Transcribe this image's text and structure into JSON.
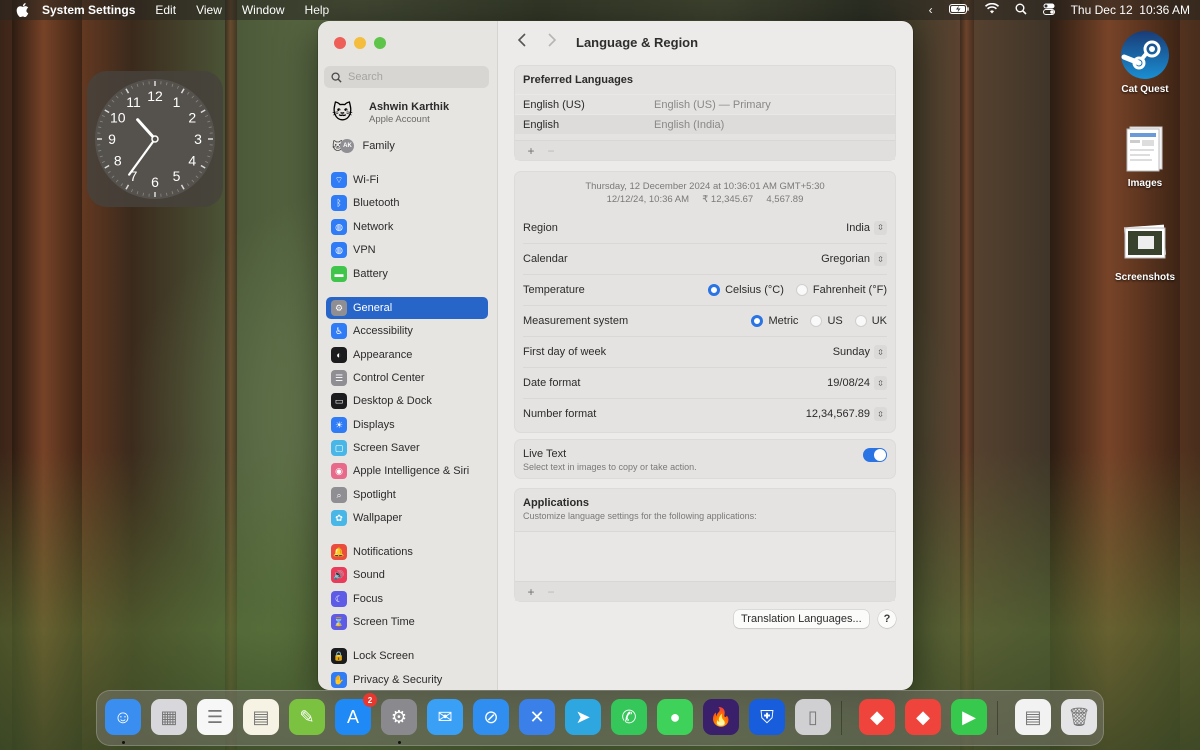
{
  "menubar": {
    "app_name": "System Settings",
    "menus": [
      "Edit",
      "View",
      "Window",
      "Help"
    ],
    "status_icons": [
      "chevron-left-icon",
      "battery-charging-icon",
      "wifi-icon",
      "search-icon",
      "control-center-icon"
    ],
    "datetime": "Thu Dec 12  10:36 AM"
  },
  "clock_widget": {
    "numbers": [
      "12",
      "1",
      "2",
      "3",
      "4",
      "5",
      "6",
      "7",
      "8",
      "9",
      "10",
      "11"
    ],
    "hour": 10,
    "minute": 36
  },
  "desktop_icons": [
    {
      "label": "Cat Quest",
      "icon": "steam-icon"
    },
    {
      "label": "Images",
      "icon": "folder-stack-icon"
    },
    {
      "label": "Screenshots",
      "icon": "screenshot-stack-icon"
    }
  ],
  "window": {
    "search_placeholder": "Search",
    "account": {
      "name": "Ashwin Karthik",
      "subtitle": "Apple Account"
    },
    "family": {
      "label": "Family",
      "initials": "AK"
    },
    "sidebar": [
      {
        "label": "Wi-Fi",
        "icon": "wifi-icon",
        "color": "#2f7cf6"
      },
      {
        "label": "Bluetooth",
        "icon": "bluetooth-icon",
        "color": "#2f7cf6"
      },
      {
        "label": "Network",
        "icon": "globe-icon",
        "color": "#2f7cf6"
      },
      {
        "label": "VPN",
        "icon": "vpn-icon",
        "color": "#2f7cf6"
      },
      {
        "label": "Battery",
        "icon": "battery-icon",
        "color": "#3fc54a"
      },
      {
        "label": "General",
        "icon": "gear-icon",
        "color": "#8e8e93",
        "selected": true
      },
      {
        "label": "Accessibility",
        "icon": "accessibility-icon",
        "color": "#2f7cf6"
      },
      {
        "label": "Appearance",
        "icon": "appearance-icon",
        "color": "#1c1c1e"
      },
      {
        "label": "Control Center",
        "icon": "control-center-icon",
        "color": "#8e8e93"
      },
      {
        "label": "Desktop & Dock",
        "icon": "dock-icon",
        "color": "#1c1c1e"
      },
      {
        "label": "Displays",
        "icon": "sun-icon",
        "color": "#2f7cf6"
      },
      {
        "label": "Screen Saver",
        "icon": "screen-saver-icon",
        "color": "#48b7e8"
      },
      {
        "label": "Apple Intelligence & Siri",
        "icon": "siri-icon",
        "color": "#e86a8a"
      },
      {
        "label": "Spotlight",
        "icon": "spotlight-icon",
        "color": "#8e8e93"
      },
      {
        "label": "Wallpaper",
        "icon": "wallpaper-icon",
        "color": "#48b7e8"
      },
      {
        "label": "Notifications",
        "icon": "bell-icon",
        "color": "#eb4d3d"
      },
      {
        "label": "Sound",
        "icon": "speaker-icon",
        "color": "#eb3b5a"
      },
      {
        "label": "Focus",
        "icon": "moon-icon",
        "color": "#5e5ce6"
      },
      {
        "label": "Screen Time",
        "icon": "hourglass-icon",
        "color": "#5e5ce6"
      },
      {
        "label": "Lock Screen",
        "icon": "lock-icon",
        "color": "#1c1c1e"
      },
      {
        "label": "Privacy & Security",
        "icon": "hand-icon",
        "color": "#2f7cf6"
      }
    ],
    "title": "Language & Region",
    "preferred_languages": {
      "heading": "Preferred Languages",
      "rows": [
        {
          "name": "English (US)",
          "detail": "English (US) — Primary"
        },
        {
          "name": "English",
          "detail": "English (India)"
        }
      ],
      "add": "+",
      "remove": "−"
    },
    "preview": {
      "line1": "Thursday, 12 December 2024 at 10:36:01 AM GMT+5:30",
      "line2": "12/12/24, 10:36 AM     ₹ 12,345.67     4,567.89"
    },
    "settings": {
      "region": {
        "label": "Region",
        "value": "India"
      },
      "calendar": {
        "label": "Calendar",
        "value": "Gregorian"
      },
      "temperature": {
        "label": "Temperature",
        "options": [
          "Celsius (°C)",
          "Fahrenheit (°F)"
        ],
        "selected": "Celsius (°C)"
      },
      "measurement": {
        "label": "Measurement system",
        "options": [
          "Metric",
          "US",
          "UK"
        ],
        "selected": "Metric"
      },
      "first_day": {
        "label": "First day of week",
        "value": "Sunday"
      },
      "date_format": {
        "label": "Date format",
        "value": "19/08/24"
      },
      "number_format": {
        "label": "Number format",
        "value": "12,34,567.89"
      }
    },
    "live_text": {
      "label": "Live Text",
      "description": "Select text in images to copy or take action.",
      "enabled": true
    },
    "applications": {
      "heading": "Applications",
      "description": "Customize language settings for the following applications:",
      "add": "+",
      "remove": "−"
    },
    "translation_button": "Translation Languages...",
    "help_button": "?"
  },
  "dock": {
    "apps": [
      {
        "name": "Finder",
        "icon": "finder-icon",
        "color": "#3a8ef0",
        "running": true
      },
      {
        "name": "Launchpad",
        "icon": "launchpad-icon",
        "color": "#d8d8dc"
      },
      {
        "name": "Reminders",
        "icon": "reminders-icon",
        "color": "#f7f7f7"
      },
      {
        "name": "Notes",
        "icon": "notes-icon",
        "color": "#f6f3e4"
      },
      {
        "name": "Maps Editor",
        "icon": "map-pen-icon",
        "color": "#7cc241"
      },
      {
        "name": "App Store",
        "icon": "app-store-icon",
        "color": "#1f8af5",
        "badge": "2"
      },
      {
        "name": "System Settings",
        "icon": "gear-icon",
        "color": "#8a8a8e",
        "running": true
      },
      {
        "name": "Mail",
        "icon": "mail-icon",
        "color": "#3aa0f5"
      },
      {
        "name": "Safari",
        "icon": "safari-icon",
        "color": "#2f8ef0"
      },
      {
        "name": "NetNewsWire",
        "icon": "satellite-icon",
        "color": "#3a80e8"
      },
      {
        "name": "Telegram",
        "icon": "telegram-icon",
        "color": "#2ea6e0"
      },
      {
        "name": "WhatsApp",
        "icon": "whatsapp-icon",
        "color": "#35c75a"
      },
      {
        "name": "Messages",
        "icon": "messages-icon",
        "color": "#3fd25a"
      },
      {
        "name": "Firefox",
        "icon": "firefox-icon",
        "color": "#3a1f6b"
      },
      {
        "name": "Bitwarden",
        "icon": "bitwarden-icon",
        "color": "#175ddc"
      },
      {
        "name": "iPhone Mirroring",
        "icon": "iphone-icon",
        "color": "#d0d0d2"
      },
      {
        "name": "AnyDesk",
        "icon": "anydesk-icon",
        "color": "#ef443b"
      },
      {
        "name": "AnyDesk",
        "icon": "anydesk-icon",
        "color": "#ef443b"
      },
      {
        "name": "FaceTime",
        "icon": "facetime-icon",
        "color": "#36c94d"
      },
      {
        "name": "Disk Image",
        "icon": "disk-image-icon",
        "color": "#f2f2f2"
      },
      {
        "name": "Trash",
        "icon": "trash-icon",
        "color": "#e4e4e6"
      }
    ]
  }
}
